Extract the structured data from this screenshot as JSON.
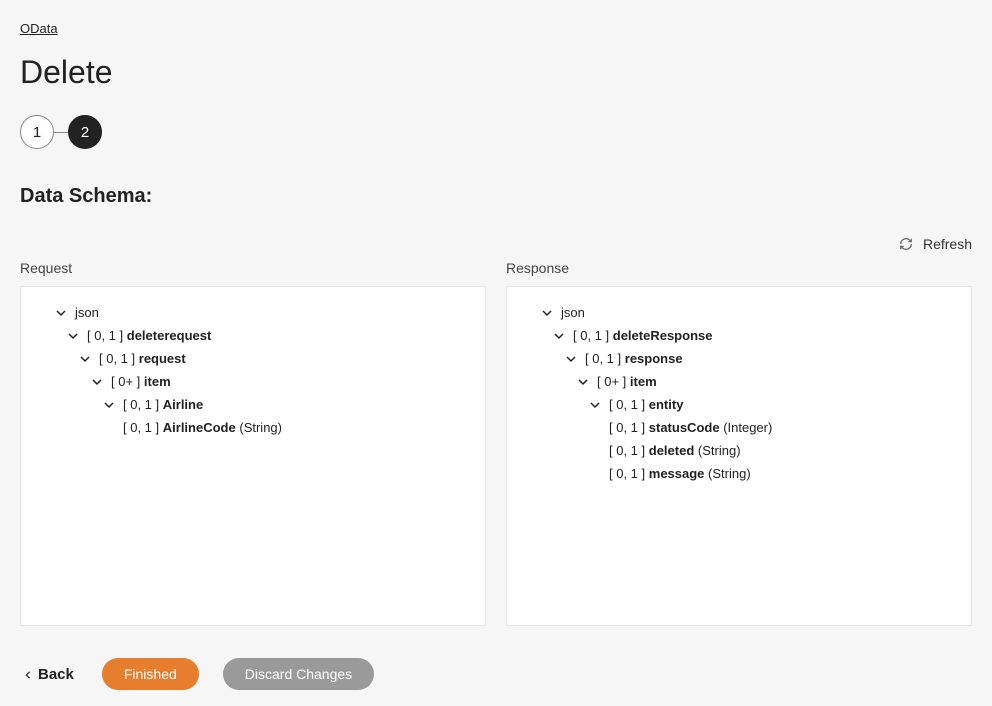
{
  "breadcrumb": {
    "label": "OData"
  },
  "page_title": "Delete",
  "stepper": {
    "step1": "1",
    "step2": "2"
  },
  "section_title": "Data Schema:",
  "refresh_label": "Refresh",
  "request_label": "Request",
  "response_label": "Response",
  "request_tree": {
    "root": "json",
    "n1_card": "[ 0, 1 ]",
    "n1_name": "deleterequest",
    "n2_card": "[ 0, 1 ]",
    "n2_name": "request",
    "n3_card": "[ 0+ ]",
    "n3_name": "item",
    "n4_card": "[ 0, 1 ]",
    "n4_name": "Airline",
    "n5_card": "[ 0, 1 ]",
    "n5_name": "AirlineCode",
    "n5_type": "(String)"
  },
  "response_tree": {
    "root": "json",
    "n1_card": "[ 0, 1 ]",
    "n1_name": "deleteResponse",
    "n2_card": "[ 0, 1 ]",
    "n2_name": "response",
    "n3_card": "[ 0+ ]",
    "n3_name": "item",
    "n4_card": "[ 0, 1 ]",
    "n4_name": "entity",
    "n5_card": "[ 0, 1 ]",
    "n5_name": "statusCode",
    "n5_type": "(Integer)",
    "n6_card": "[ 0, 1 ]",
    "n6_name": "deleted",
    "n6_type": "(String)",
    "n7_card": "[ 0, 1 ]",
    "n7_name": "message",
    "n7_type": "(String)"
  },
  "footer": {
    "back": "Back",
    "finished": "Finished",
    "discard": "Discard Changes"
  }
}
